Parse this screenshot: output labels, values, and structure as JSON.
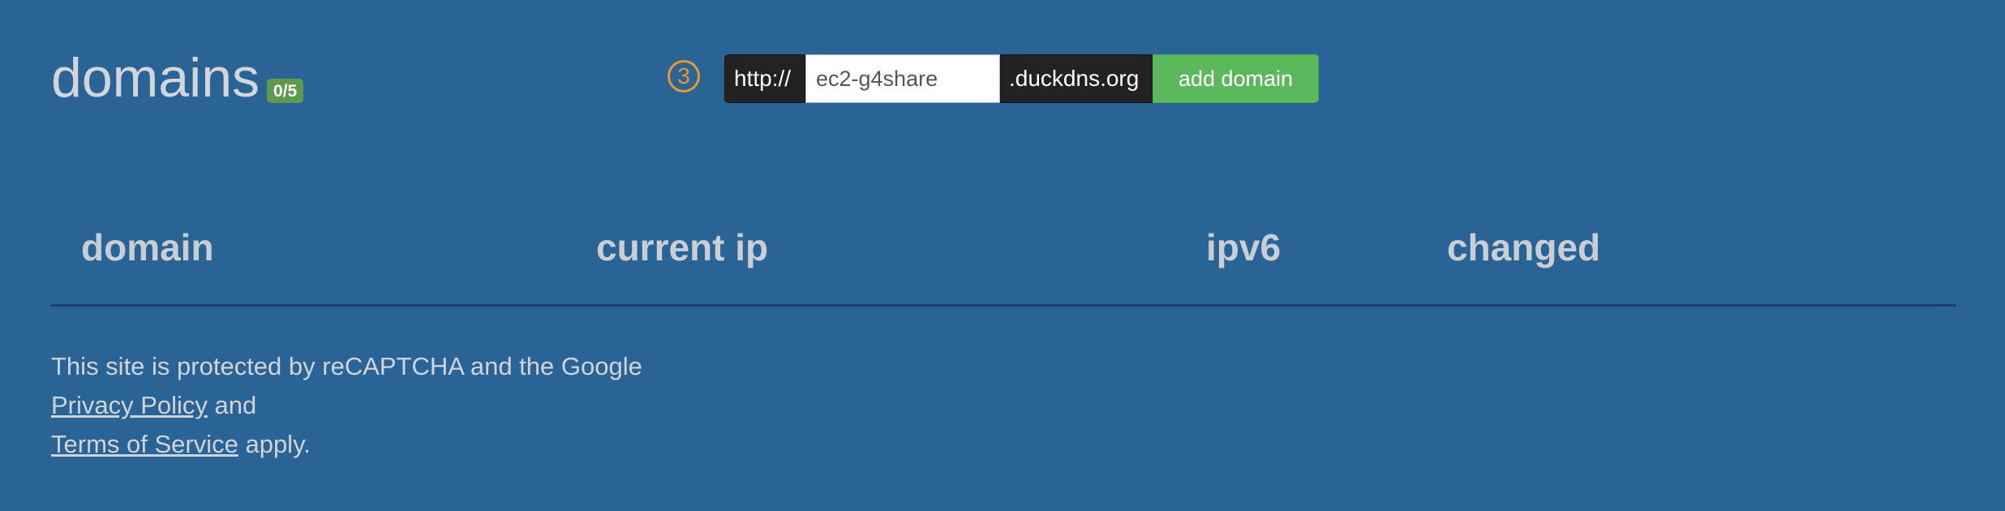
{
  "header": {
    "title": "domains",
    "badge": "0/5"
  },
  "add_form": {
    "step_number": "3",
    "prefix": "http://",
    "domain_value": "ec2-g4share",
    "suffix": ".duckdns.org",
    "add_button_label": "add domain",
    "accent_color": "#e69a2e",
    "button_color": "#5cb85c"
  },
  "table": {
    "columns": [
      "domain",
      "current ip",
      "ipv6",
      "changed"
    ],
    "rows": []
  },
  "footer": {
    "line1": "This site is protected by reCAPTCHA and the Google",
    "privacy_link": "Privacy Policy",
    "and_text": " and",
    "terms_link": "Terms of Service",
    "apply_text": " apply."
  },
  "theme": {
    "background": "#2a6496",
    "divider": "#1a3f70"
  }
}
